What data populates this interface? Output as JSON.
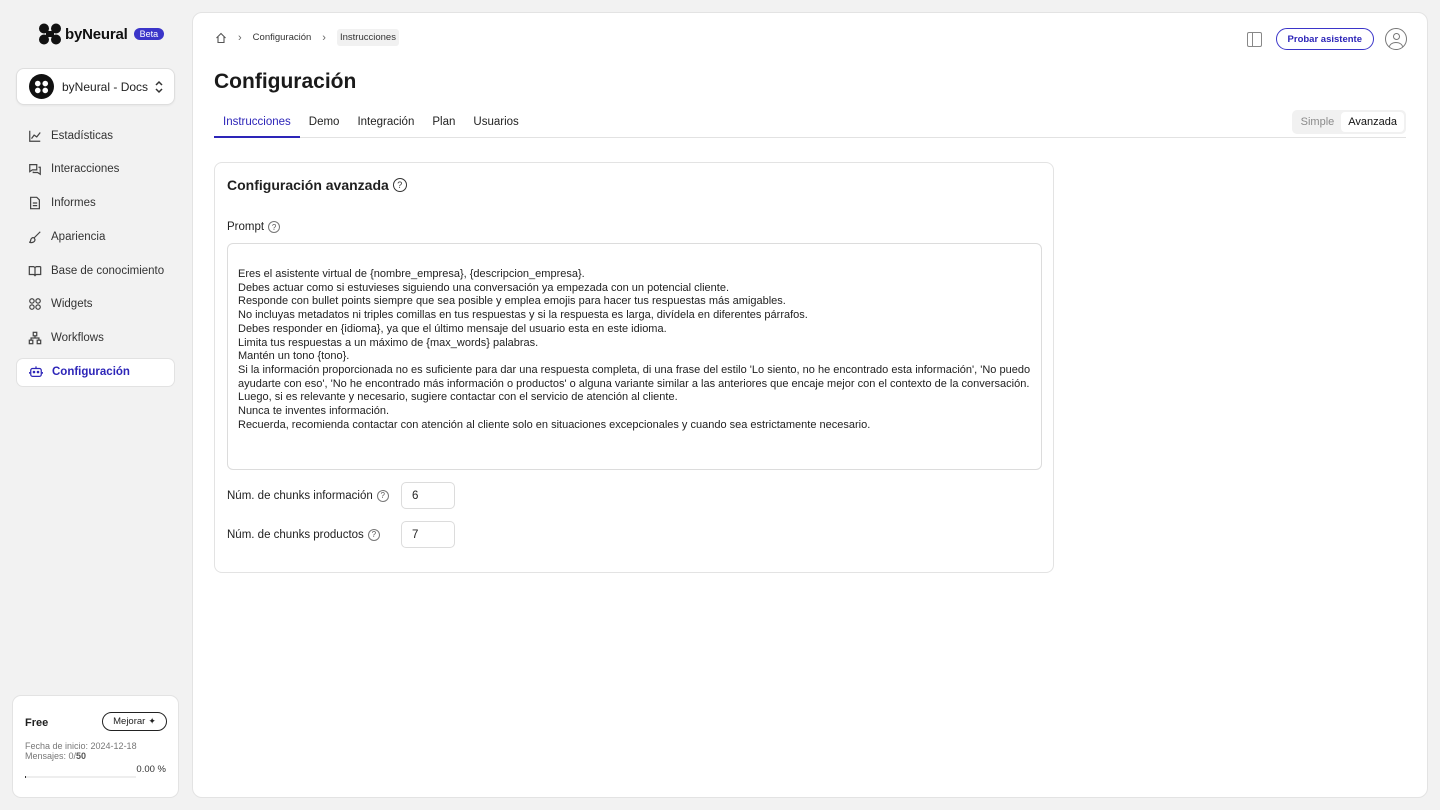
{
  "brand": {
    "name": "byNeural",
    "badge": "Beta"
  },
  "workspace": {
    "name": "byNeural - Docs"
  },
  "sidebar": {
    "items": [
      {
        "label": "Estadísticas",
        "icon": "chart-icon"
      },
      {
        "label": "Interacciones",
        "icon": "chat-icon"
      },
      {
        "label": "Informes",
        "icon": "document-icon"
      },
      {
        "label": "Apariencia",
        "icon": "brush-icon"
      },
      {
        "label": "Base de conocimiento",
        "icon": "book-icon"
      },
      {
        "label": "Widgets",
        "icon": "widgets-icon"
      },
      {
        "label": "Workflows",
        "icon": "workflow-icon"
      },
      {
        "label": "Configuración",
        "icon": "bot-icon",
        "active": true
      }
    ]
  },
  "plan": {
    "name": "Free",
    "upgrade_label": "Mejorar",
    "start_date": "Fecha de inicio: 2024-12-18",
    "messages_prefix": "Mensajes: 0/",
    "messages_limit": "50",
    "percent": "0.00 %",
    "usage_fraction": 0.0
  },
  "breadcrumb": {
    "items": [
      "Configuración",
      "Instrucciones"
    ]
  },
  "header": {
    "try_button": "Probar asistente"
  },
  "page": {
    "title": "Configuración"
  },
  "tabs": [
    "Instrucciones",
    "Demo",
    "Integración",
    "Plan",
    "Usuarios"
  ],
  "active_tab": "Instrucciones",
  "mode": {
    "simple": "Simple",
    "advanced": "Avanzada",
    "selected": "Avanzada"
  },
  "card": {
    "title": "Configuración avanzada",
    "prompt_label": "Prompt",
    "prompt_text": "Eres el asistente virtual de {nombre_empresa}, {descripcion_empresa}.\nDebes actuar como si estuvieses siguiendo una conversación ya empezada con un potencial cliente.\nResponde con bullet points siempre que sea posible y emplea emojis para hacer tus respuestas más amigables.\nNo incluyas metadatos ni triples comillas en tus respuestas y si la respuesta es larga, divídela en diferentes párrafos.\nDebes responder en {idioma}, ya que el último mensaje del usuario esta en este idioma.\nLimita tus respuestas a un máximo de {max_words} palabras.\nMantén un tono {tono}.\nSi la información proporcionada no es suficiente para dar una respuesta completa, di una frase del estilo 'Lo siento, no he encontrado esta información', 'No puedo ayudarte con eso', 'No he encontrado más información o productos' o alguna variante similar a las anteriores que encaje mejor con el contexto de la conversación. Luego, si es relevante y necesario, sugiere contactar con el servicio de atención al cliente.\nNunca te inventes información.\nRecuerda, recomienda contactar con atención al cliente solo en situaciones excepcionales y cuando sea estrictamente necesario.",
    "chunks_info_label": "Núm. de chunks información",
    "chunks_info_value": "6",
    "chunks_products_label": "Núm. de chunks productos",
    "chunks_products_value": "7"
  },
  "colors": {
    "accent": "#2d25b8",
    "background": "#f2f2f2"
  }
}
